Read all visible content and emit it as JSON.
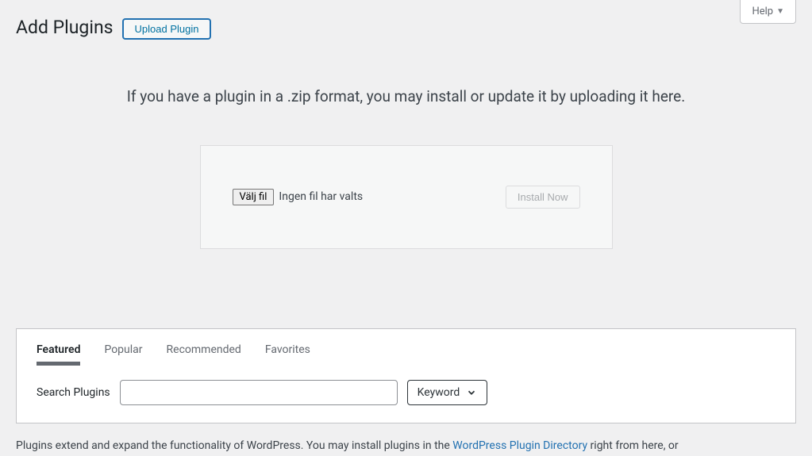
{
  "help": {
    "label": "Help"
  },
  "header": {
    "title": "Add Plugins",
    "upload_btn": "Upload Plugin"
  },
  "upload": {
    "instructions": "If you have a plugin in a .zip format, you may install or update it by uploading it here.",
    "file_btn": "Välj fil",
    "file_status": "Ingen fil har valts",
    "install_btn": "Install Now"
  },
  "tabs": {
    "featured": "Featured",
    "popular": "Popular",
    "recommended": "Recommended",
    "favorites": "Favorites"
  },
  "search": {
    "label": "Search Plugins",
    "keyword": "Keyword"
  },
  "footer": {
    "text_1": "Plugins extend and expand the functionality of WordPress. You may install plugins in the ",
    "link": "WordPress Plugin Directory",
    "text_2": " right from here, or"
  }
}
